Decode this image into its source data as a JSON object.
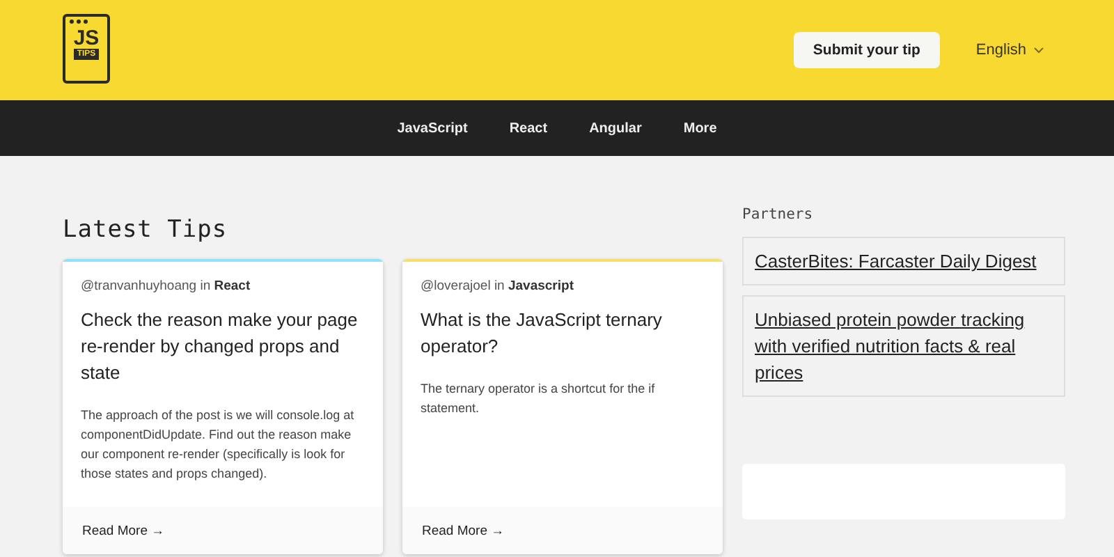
{
  "logo": {
    "title": "JS",
    "subtitle": "TIPS"
  },
  "submit_button": "Submit your tip",
  "language": "English",
  "nav": [
    "JavaScript",
    "React",
    "Angular",
    "More"
  ],
  "heading": "Latest Tips",
  "tips": [
    {
      "author": "@tranvanhuyhoang",
      "in": "in",
      "category": "React",
      "color": "#8ee3fb",
      "title": "Check the reason make your page re-render by changed props and state",
      "description": "The approach of the post is we will console.log at componentDidUpdate. Find out the reason make our component re-render (specifically is look for those states and props changed).",
      "link": "Read More →"
    },
    {
      "author": "@loverajoel",
      "in": "in",
      "category": "Javascript",
      "color": "#f8de6a",
      "title": "What is the JavaScript ternary operator?",
      "description": "The ternary operator is a shortcut for the if statement.",
      "link": "Read More →"
    }
  ],
  "partners": {
    "title": "Partners",
    "links": [
      "CasterBites: Farcaster Daily Digest",
      "Unbiased protein powder tracking with verified nutrition facts & real prices"
    ]
  }
}
